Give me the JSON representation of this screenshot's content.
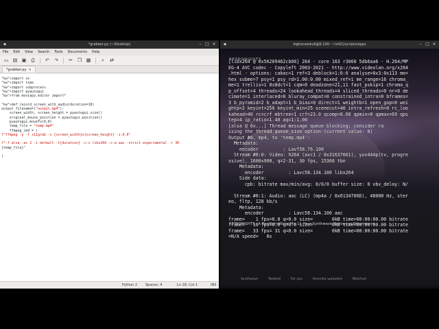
{
  "editor": {
    "title": "*grabber.py (~/Desktop)",
    "window_controls": [
      "–",
      "□",
      "✕"
    ],
    "menu": [
      "File",
      "Edit",
      "View",
      "Search",
      "Tools",
      "Documents",
      "Help"
    ],
    "toolbar_icons": [
      "new-document-icon",
      "open-icon",
      "save-icon",
      "print-icon",
      "undo-icon",
      "redo-icon",
      "cut-icon",
      "copy-icon",
      "paste-icon",
      "search-icon",
      "replace-icon"
    ],
    "tab_label": "*grabber.py",
    "tab_close": "✕",
    "code_lines": [
      "import os",
      "import time",
      "import subprocess",
      "import pyautogui",
      "from moviepy.editor import*",
      "",
      "def record_screen_with_audio(duration=10)",
      "output_filename=(\"output.mp4\"):",
      "    screen_width, screen_height = pyautogui.size()",
      "    original_mouse_position = pyautogui.position()",
      "    pyautogui.moveTo(0,0)",
      "    temp_file = \"temp.mp4\"",
      "    ffmpeg_cmd = (",
      "f\"ffmpeg -y -f x11grab -s {screen_width}x{screen_height} -i:0.0\"",
      "",
      "f\"-f alsa -ac 2 -i default -t{duration} -c:v libx264 -c:a aac -strict experimental -r 30",
      "{temp_file}\"",
      "",
      ")"
    ],
    "status": {
      "language": "Python 2",
      "spaces": "Spaces: 4",
      "position": "Ln 18, Col 1",
      "mode": "INS"
    }
  },
  "terminal": {
    "title": "bighorseskull@6-100: ~/x421/scriptz/apps",
    "window_controls": [
      "–",
      "□",
      "✕"
    ],
    "video_brand": "RETRONIGHTS",
    "video_title": "RETRONIGHTS - A NewRetroWave Mix 11 Hour Synthwave Retrowave Dreamwave",
    "video_tabs": [
      "Synthwave",
      "Related",
      "For you",
      "Recently uploaded",
      "Watched"
    ],
    "lines": [
      "[libx264 @ 0x56209462cb00] 264 - core 163 r3060 5db6aa6 - H.264/MP",
      "EG-4 AVC codec - Copyleft 2003-2021 - http://www.videolan.org/x264",
      ".html - options: cabac=1 ref=3 deblock=1:0:0 analyse=0x3:0x113 me=",
      "hex subme=7 psy=1 psy_rd=1.00:0.00 mixed_ref=1 me_range=16 chroma_",
      "me=1 trellis=1 8x8dct=1 cqm=0 deadzone=21,11 fast_pskip=1 chroma_q",
      "p_offset=4 threads=24 lookahead_threads=4 sliced_threads=0 nr=0 de",
      "cimate=1 interlaced=0 bluray_compat=0 constrained_intra=0 bframes=",
      "3 b_pyramid=2 b_adapt=1 b_bias=0 direct=1 weightb=1 open_gop=0 wei",
      "ghtp=2 keyint=250 keyint_min=25 scenecut=40 intra_refresh=0 rc_loo",
      "kahead=40 rc=crf mbtree=1 crf=23.0 qcomp=0.60 qpmin=0 qpmax=69 qps",
      "tep=4 ip_ratio=1.40 aq=1:1.00",
      "[alsa @ 0x...] Thread message queue blocking; consider ra",
      "ising the thread_queue_size option (current value: 8)",
      "Output #0, mp4, to 'temp.mp4':",
      "  Metadata:",
      "    encoder         : Lavf58.76.100",
      "  Stream #0:0: Video: h264 (avc1 / 0x31637661), yuv444p(tv, progre",
      "ssive), 1600x900, q=2-31, 30 fps, 15360 tbn",
      "    Metadata:",
      "      encoder         : Lavc58.134.100 libx264",
      "    Side data:",
      "      cpb: bitrate max/min/avg: 0/0/0 buffer size: 0 vbv_delay: N/",
      "",
      "  Stream #0:1: Audio: aac (LC) (mp4a / 0x6134706D), 48000 Hz, ster",
      "eo, fltp, 128 kb/s",
      "    Metadata:",
      "      encoder         : Lavc58.134.100 aac",
      "frame=    1 fps=0.0 q=0.0 size=       0kB time=00:00:00.00 bitrate",
      "frame=   16 fps=0.0 q=0.0 size=       0kB time=00:00:00.00 bitrate",
      "frame=   33 fps= 31 q=0.0 size=       0kB time=00:00:00.00 bitrate",
      "=N/A speed=   0x"
    ]
  }
}
